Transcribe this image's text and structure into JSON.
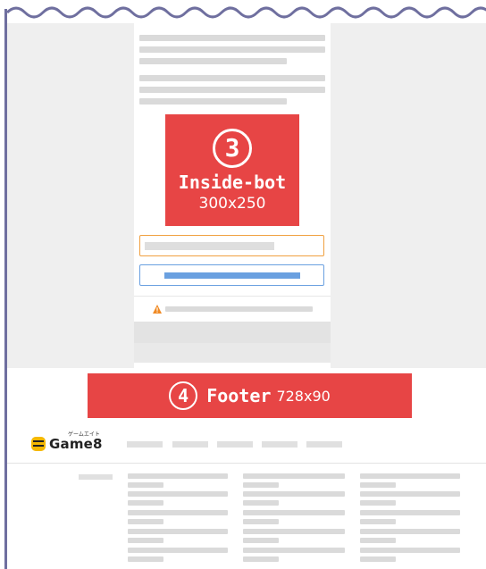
{
  "inside_ad": {
    "number": "3",
    "title": "Inside-bot",
    "size": "300x250"
  },
  "footer_ad": {
    "number": "4",
    "title": "Footer",
    "size": "728x90"
  },
  "brand": {
    "logo_text": "Game8",
    "logo_kana": "ゲームエイト"
  },
  "colors": {
    "ad_red": "#e74545",
    "accent_orange": "#f0a040",
    "accent_blue": "#6aa0e0",
    "rule": "#6f6f9f"
  },
  "icons": {
    "warning": "warning-icon",
    "logo": "game8-logo-icon"
  }
}
